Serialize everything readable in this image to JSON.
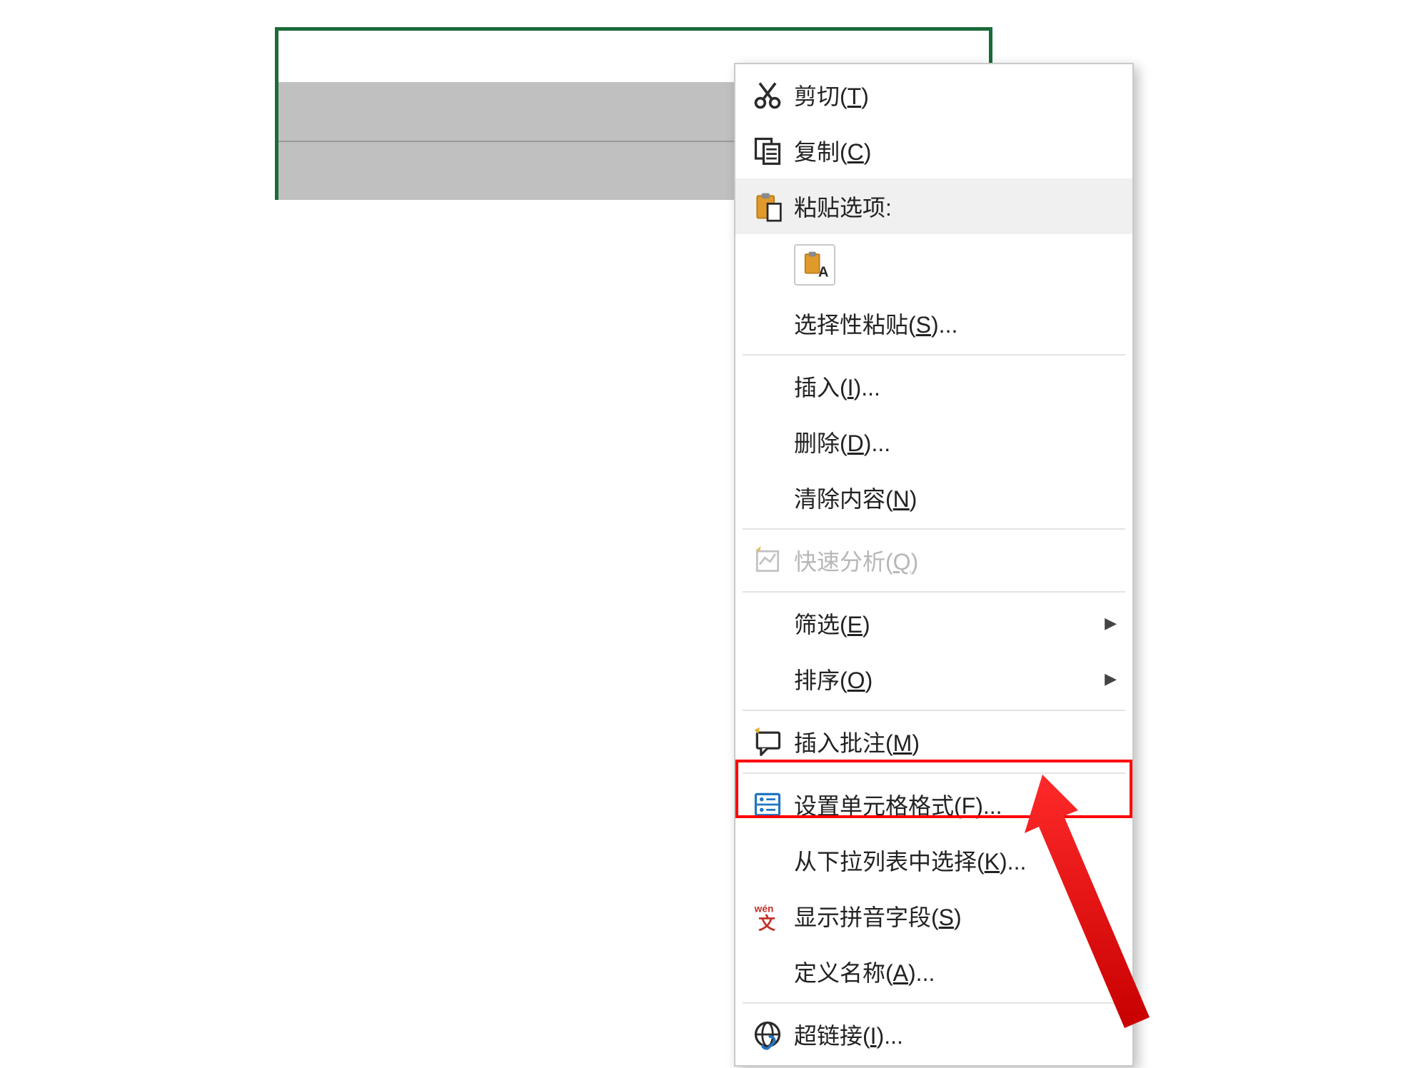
{
  "menu": {
    "cut": {
      "text": "剪切",
      "hotkey": "T"
    },
    "copy": {
      "text": "复制",
      "hotkey": "C"
    },
    "paste_options": {
      "text": "粘贴选项:"
    },
    "paste_special": {
      "text": "选择性粘贴",
      "hotkey": "S",
      "suffix": "..."
    },
    "insert": {
      "text": "插入",
      "hotkey": "I",
      "suffix": "..."
    },
    "delete": {
      "text": "删除",
      "hotkey": "D",
      "suffix": "..."
    },
    "clear_contents": {
      "text": "清除内容",
      "hotkey": "N"
    },
    "quick_analysis": {
      "text": "快速分析",
      "hotkey": "Q"
    },
    "filter": {
      "text": "筛选",
      "hotkey": "E"
    },
    "sort": {
      "text": "排序",
      "hotkey": "O"
    },
    "insert_comment": {
      "text": "插入批注",
      "hotkey": "M"
    },
    "format_cells": {
      "text": "设置单元格格式",
      "hotkey": "F",
      "suffix": "..."
    },
    "pick_from_list": {
      "text": "从下拉列表中选择",
      "hotkey": "K",
      "suffix": "..."
    },
    "show_pinyin": {
      "text": "显示拼音字段",
      "hotkey": "S"
    },
    "define_name": {
      "text": "定义名称",
      "hotkey": "A",
      "suffix": "..."
    },
    "hyperlink": {
      "text": "超链接",
      "hotkey": "I",
      "suffix": "..."
    }
  }
}
